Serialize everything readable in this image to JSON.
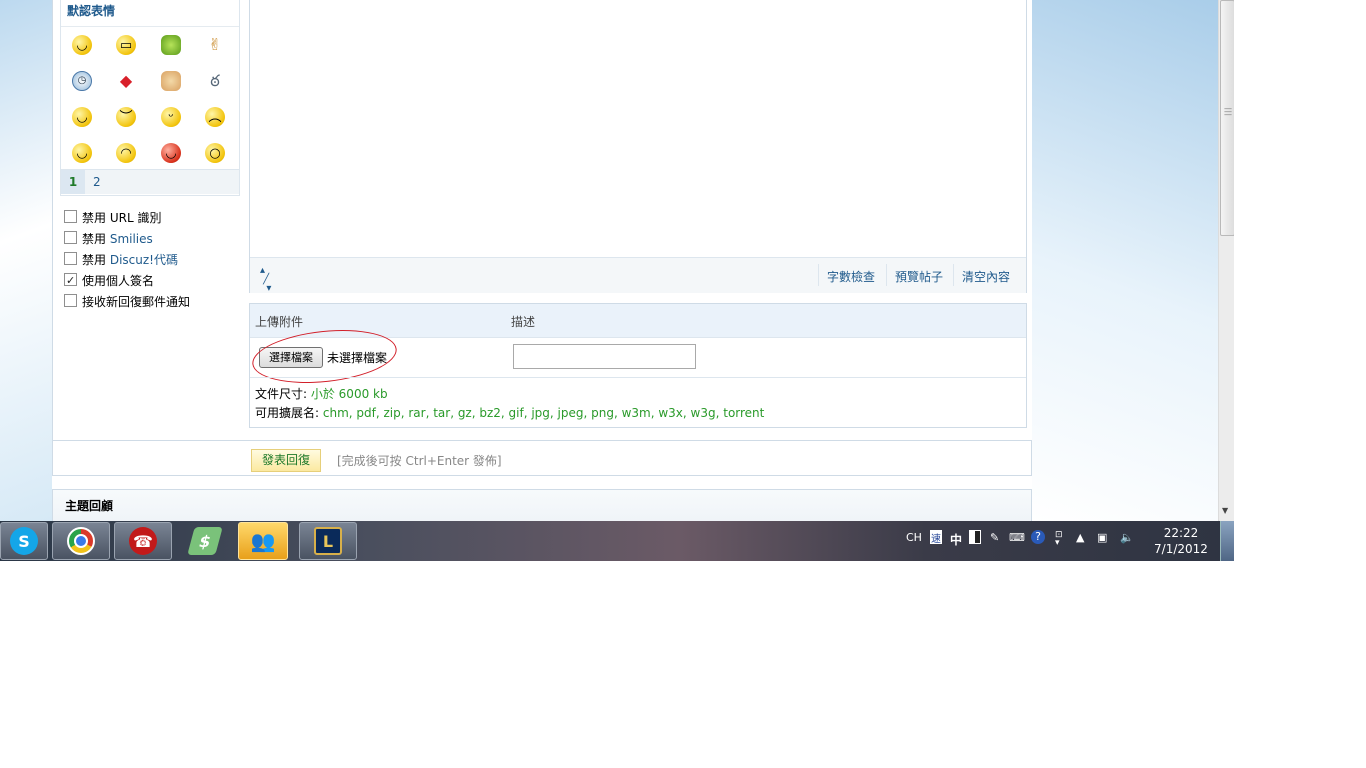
{
  "sidebar": {
    "smiley_title": "默認表情",
    "smiley_pages": [
      "1",
      "2"
    ],
    "smiley_icons": [
      "smile-icon",
      "grin-icon",
      "person-icon",
      "victory-hand-icon",
      "clock-icon",
      "lips-icon",
      "handshake-icon",
      "snail-icon",
      "blush-icon",
      "angry-icon",
      "tongue-icon",
      "sad-icon",
      "happy-icon",
      "cry-icon",
      "devil-icon",
      "confused-icon"
    ],
    "options": [
      {
        "prefix": "禁用 ",
        "link": "",
        "text": "URL 識別",
        "checked": false
      },
      {
        "prefix": "禁用 ",
        "link": "Smilies",
        "text": "",
        "checked": false
      },
      {
        "prefix": "禁用 ",
        "link": "Discuz!代碼",
        "text": "",
        "checked": false
      },
      {
        "prefix": "",
        "link": "",
        "text": "使用個人簽名",
        "checked": true
      },
      {
        "prefix": "",
        "link": "",
        "text": "接收新回復郵件通知",
        "checked": false
      }
    ]
  },
  "editor": {
    "word_count": "字數檢查",
    "preview": "預覽帖子",
    "clear": "清空內容"
  },
  "attach": {
    "col_upload": "上傳附件",
    "col_desc": "描述",
    "choose_file": "選擇檔案",
    "no_file": "未選擇檔案",
    "size_label": "文件尺寸: ",
    "size_value": "小於 6000 kb",
    "ext_label": "可用擴展名: ",
    "ext_value": "chm, pdf, zip, rar, tar, gz, bz2, gif, jpg, jpeg, png, w3m, w3x, w3g, torrent"
  },
  "submit": {
    "label": "發表回復",
    "hint": "[完成後可按 Ctrl+Enter 發佈]"
  },
  "review": {
    "title": "主題回顧"
  },
  "taskbar": {
    "apps": [
      "skype-icon",
      "chrome-icon",
      "agent-icon",
      "money-icon",
      "messenger-icon",
      "league-of-legends-icon"
    ],
    "ime": "CH",
    "ime_mode": "中",
    "clock_time": "22:22",
    "clock_date": "7/1/2012"
  }
}
